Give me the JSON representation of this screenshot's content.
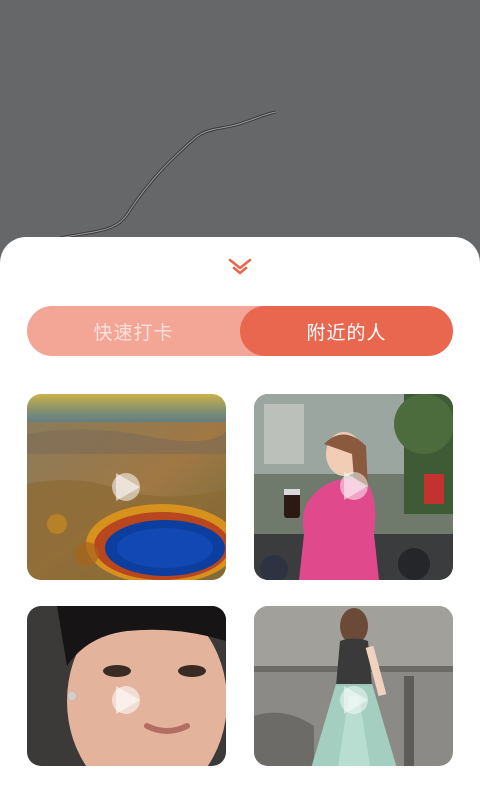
{
  "sheet": {
    "collapse_icon": "chevron-double-down-icon",
    "tabs": [
      {
        "label": "快速打卡",
        "active": false
      },
      {
        "label": "附近的人",
        "active": true
      }
    ]
  },
  "colors": {
    "accent": "#e9664f",
    "accent_light": "#f3a696",
    "backdrop": "#666769"
  },
  "cards": [
    {
      "id": "card-1",
      "thumbnail": "autumn-lake-aerial",
      "icon": "play-icon"
    },
    {
      "id": "card-2",
      "thumbnail": "woman-pink-jacket-street",
      "icon": "play-icon"
    },
    {
      "id": "card-3",
      "thumbnail": "young-man-portrait",
      "icon": "play-icon"
    },
    {
      "id": "card-4",
      "thumbnail": "woman-tulle-skirt-street",
      "icon": "play-icon"
    }
  ]
}
